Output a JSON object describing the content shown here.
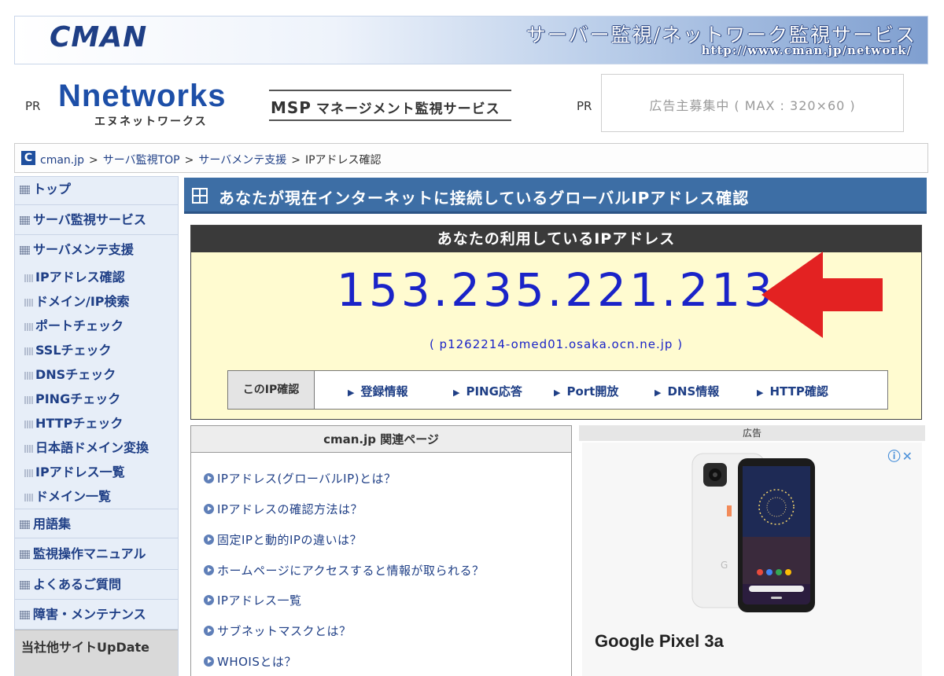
{
  "banner": {
    "logo": "CMAN",
    "title": "サーバー監視/ネットワーク監視サービス",
    "url": "http://www.cman.jp/network/"
  },
  "pr": {
    "left_label": "PR",
    "logo_main": "Nnetworks",
    "logo_sub": "エヌネットワークス",
    "msp_prefix": "MSP",
    "msp_text": "マネージメント監視サービス",
    "right_label": "PR",
    "ad_text": "広告主募集中 ( MAX : 320×60 )"
  },
  "breadcrumb": {
    "icon": "C",
    "items": [
      "cman.jp",
      "サーバ監視TOP",
      "サーバメンテ支援",
      "IPアドレス確認"
    ],
    "separator": ">"
  },
  "sidebar": {
    "items": [
      {
        "label": "トップ",
        "level": 1
      },
      {
        "label": "サーバ監視サービス",
        "level": 1
      },
      {
        "label": "サーバメンテ支援",
        "level": 1
      },
      {
        "label": "IPアドレス確認",
        "level": 2
      },
      {
        "label": "ドメイン/IP検索",
        "level": 2
      },
      {
        "label": "ポートチェック",
        "level": 2
      },
      {
        "label": "SSLチェック",
        "level": 2
      },
      {
        "label": "DNSチェック",
        "level": 2
      },
      {
        "label": "PINGチェック",
        "level": 2
      },
      {
        "label": "HTTPチェック",
        "level": 2
      },
      {
        "label": "日本語ドメイン変換",
        "level": 2
      },
      {
        "label": "IPアドレス一覧",
        "level": 2
      },
      {
        "label": "ドメイン一覧",
        "level": 2
      },
      {
        "label": "用語集",
        "level": 1
      },
      {
        "label": "監視操作マニュアル",
        "level": 1
      },
      {
        "label": "よくあるご質問",
        "level": 1
      },
      {
        "label": "障害・メンテナンス",
        "level": 1
      }
    ],
    "update_label": "当社他サイトUpDate"
  },
  "main": {
    "heading": "あなたが現在インターネットに接続しているグローバルIPアドレス確認",
    "ip_panel": {
      "header": "あなたの利用しているIPアドレス",
      "ip": "153.235.221.213",
      "hostname": "( p1262214-omed01.osaka.ocn.ne.jp )",
      "links_label": "このIP確認",
      "links": [
        "登録情報",
        "PING応答",
        "Port開放",
        "DNS情報",
        "HTTP確認"
      ]
    },
    "related": {
      "header": "cman.jp 関連ページ",
      "links": [
        "IPアドレス(グローバルIP)とは？",
        "IPアドレスの確認方法は？",
        "固定IPと動的IPの違いは？",
        "ホームページにアクセスすると情報が取られる？",
        "IPアドレス一覧",
        "サブネットマスクとは？",
        "WHOISとは？"
      ]
    },
    "ad": {
      "header": "広告",
      "info_icons": "ⓘ✕",
      "product": "Google Pixel 3a"
    }
  },
  "colors": {
    "heading_bg": "#3d6ea5",
    "ip_text": "#1a23c8",
    "ip_panel_bg": "#fffbd0",
    "link": "#1f3f86",
    "arrow": "#e32222"
  }
}
